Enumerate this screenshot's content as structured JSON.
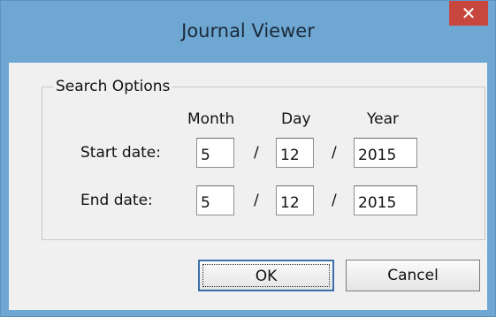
{
  "window": {
    "title": "Journal Viewer",
    "close_glyph": "✕"
  },
  "group": {
    "legend": "Search Options",
    "headers": {
      "month": "Month",
      "day": "Day",
      "year": "Year"
    },
    "separator": "/",
    "rows": [
      {
        "label": "Start date:",
        "month": "5",
        "day": "12",
        "year": "2015"
      },
      {
        "label": "End date:",
        "month": "5",
        "day": "12",
        "year": "2015"
      }
    ]
  },
  "buttons": {
    "ok": "OK",
    "cancel": "Cancel"
  }
}
